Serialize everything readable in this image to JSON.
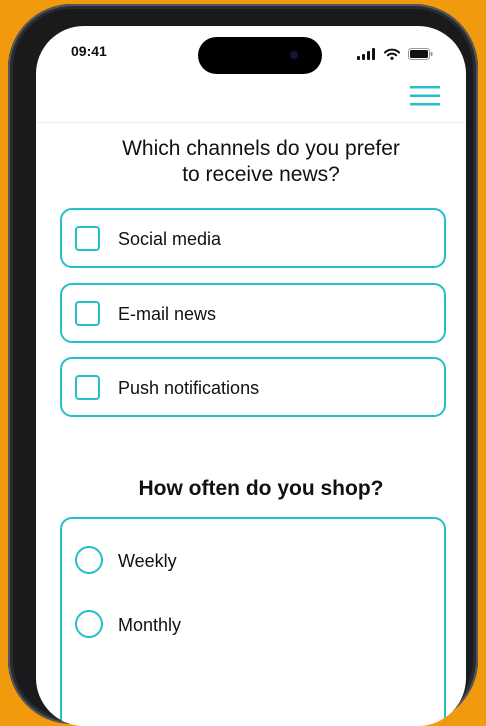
{
  "status_bar": {
    "time": "09:41"
  },
  "header": {
    "menu_icon": "hamburger-menu-icon"
  },
  "survey": {
    "question1": {
      "line1": "Which channels do you prefer",
      "line2": "to receive news?",
      "options": [
        "Social media",
        "E-mail news",
        "Push notifications"
      ]
    },
    "question2": {
      "text": "How often do you shop?",
      "options": [
        "Weekly",
        "Monthly"
      ]
    }
  },
  "colors": {
    "accent": "#23C0C9",
    "background": "#F29A0E",
    "frame": "#1A1A1C"
  }
}
